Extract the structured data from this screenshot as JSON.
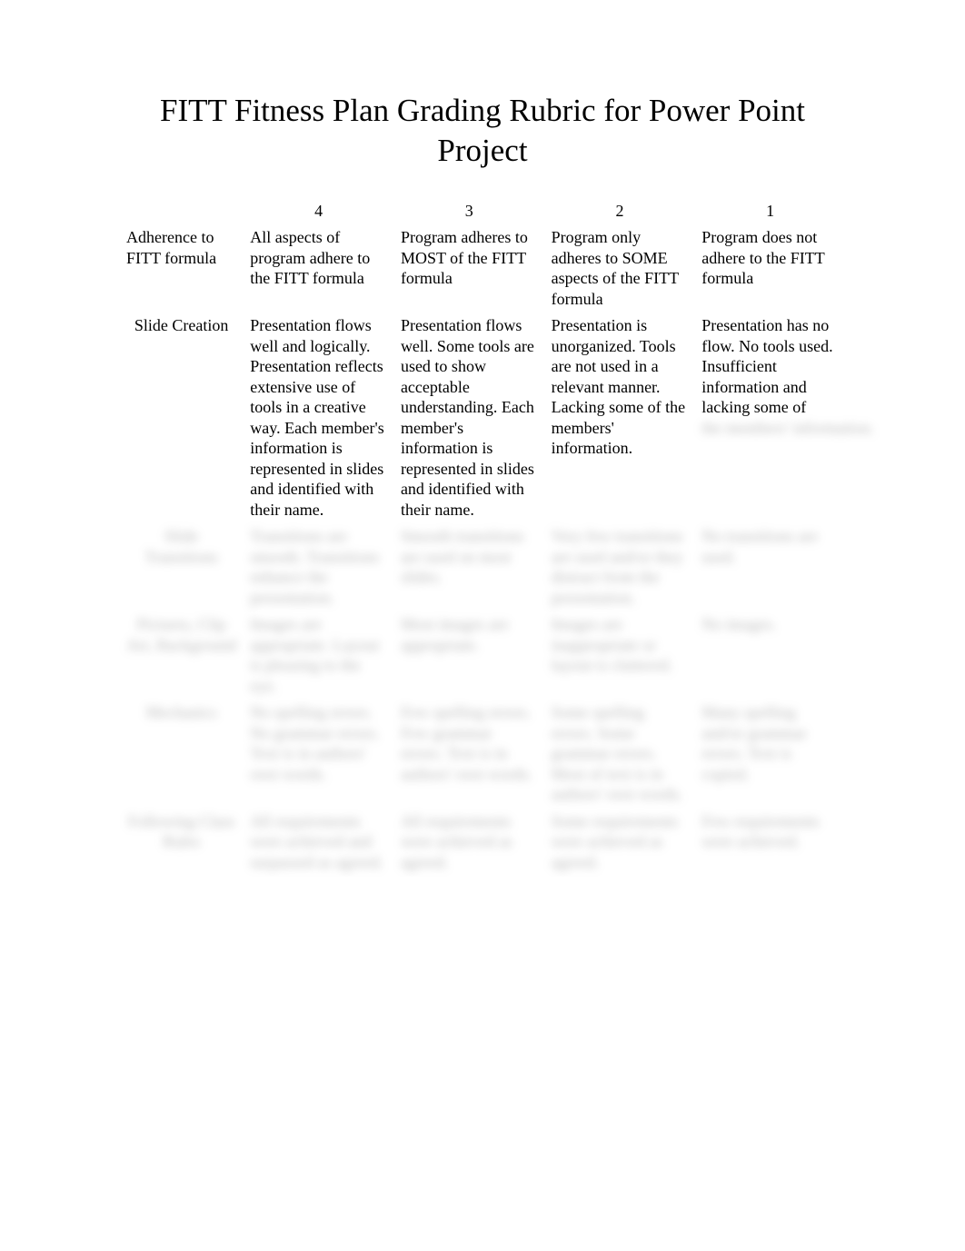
{
  "title": "FITT Fitness Plan Grading Rubric for Power Point Project",
  "chart_data": {
    "type": "table",
    "title": "FITT Fitness Plan Grading Rubric for Power Point Project",
    "columns": [
      "",
      "4",
      "3",
      "2",
      "1"
    ],
    "rows": [
      {
        "category": "Adherence to FITT formula",
        "c4": "All aspects of program adhere to the FITT formula",
        "c3": "Program adheres to MOST of  the FITT formula",
        "c2": "Program only adheres to SOME aspects of the FITT formula",
        "c1": "Program does not adhere to the FITT formula"
      },
      {
        "category": "Slide Creation",
        "c4": "Presentation flows well and logically. Presentation reflects extensive use of tools in a creative way. Each member's information is represented in slides and identified with their name.",
        "c3": "Presentation flows well. Some tools are used to show acceptable understanding. Each member's information is represented in slides and identified with their name.",
        "c2": "Presentation is unorganized. Tools are not used in a relevant manner. Lacking some of the members' information.",
        "c1": "Presentation has no flow. No tools used. Insufficient information and lacking some of",
        "c1_blurred": "the members' information."
      }
    ],
    "blurred_rows": [
      {
        "category": "Slide Transitions",
        "c4": "Transitions are smooth. Transitions enhance the presentation.",
        "c3": "Smooth transitions are used on most slides.",
        "c2": "Very few transitions are used and/or they distract from the presentation.",
        "c1": "No transitions are used."
      },
      {
        "category": "Pictures, Clip Art, Background",
        "c4": "Images are appropriate. Layout is pleasing to the eye.",
        "c3": "Most images are appropriate.",
        "c2": "Images are inappropriate or layout is cluttered.",
        "c1": "No images."
      },
      {
        "category": "Mechanics",
        "c4": "No spelling errors. No grammar errors. Text is in authors' own words.",
        "c3": "Few spelling errors. Few grammar errors. Text is in authors' own words.",
        "c2": "Some spelling errors. Some grammar errors. Most of text is in authors' own words.",
        "c1": "Many spelling and/or grammar errors. Text is copied."
      },
      {
        "category": "Following Class Rules",
        "c4": "All requirements were achieved and surpassed as agreed.",
        "c3": "All requirements were achieved as agreed.",
        "c2": "Some requirements were achieved as agreed.",
        "c1": "Few requirements were achieved."
      }
    ]
  }
}
